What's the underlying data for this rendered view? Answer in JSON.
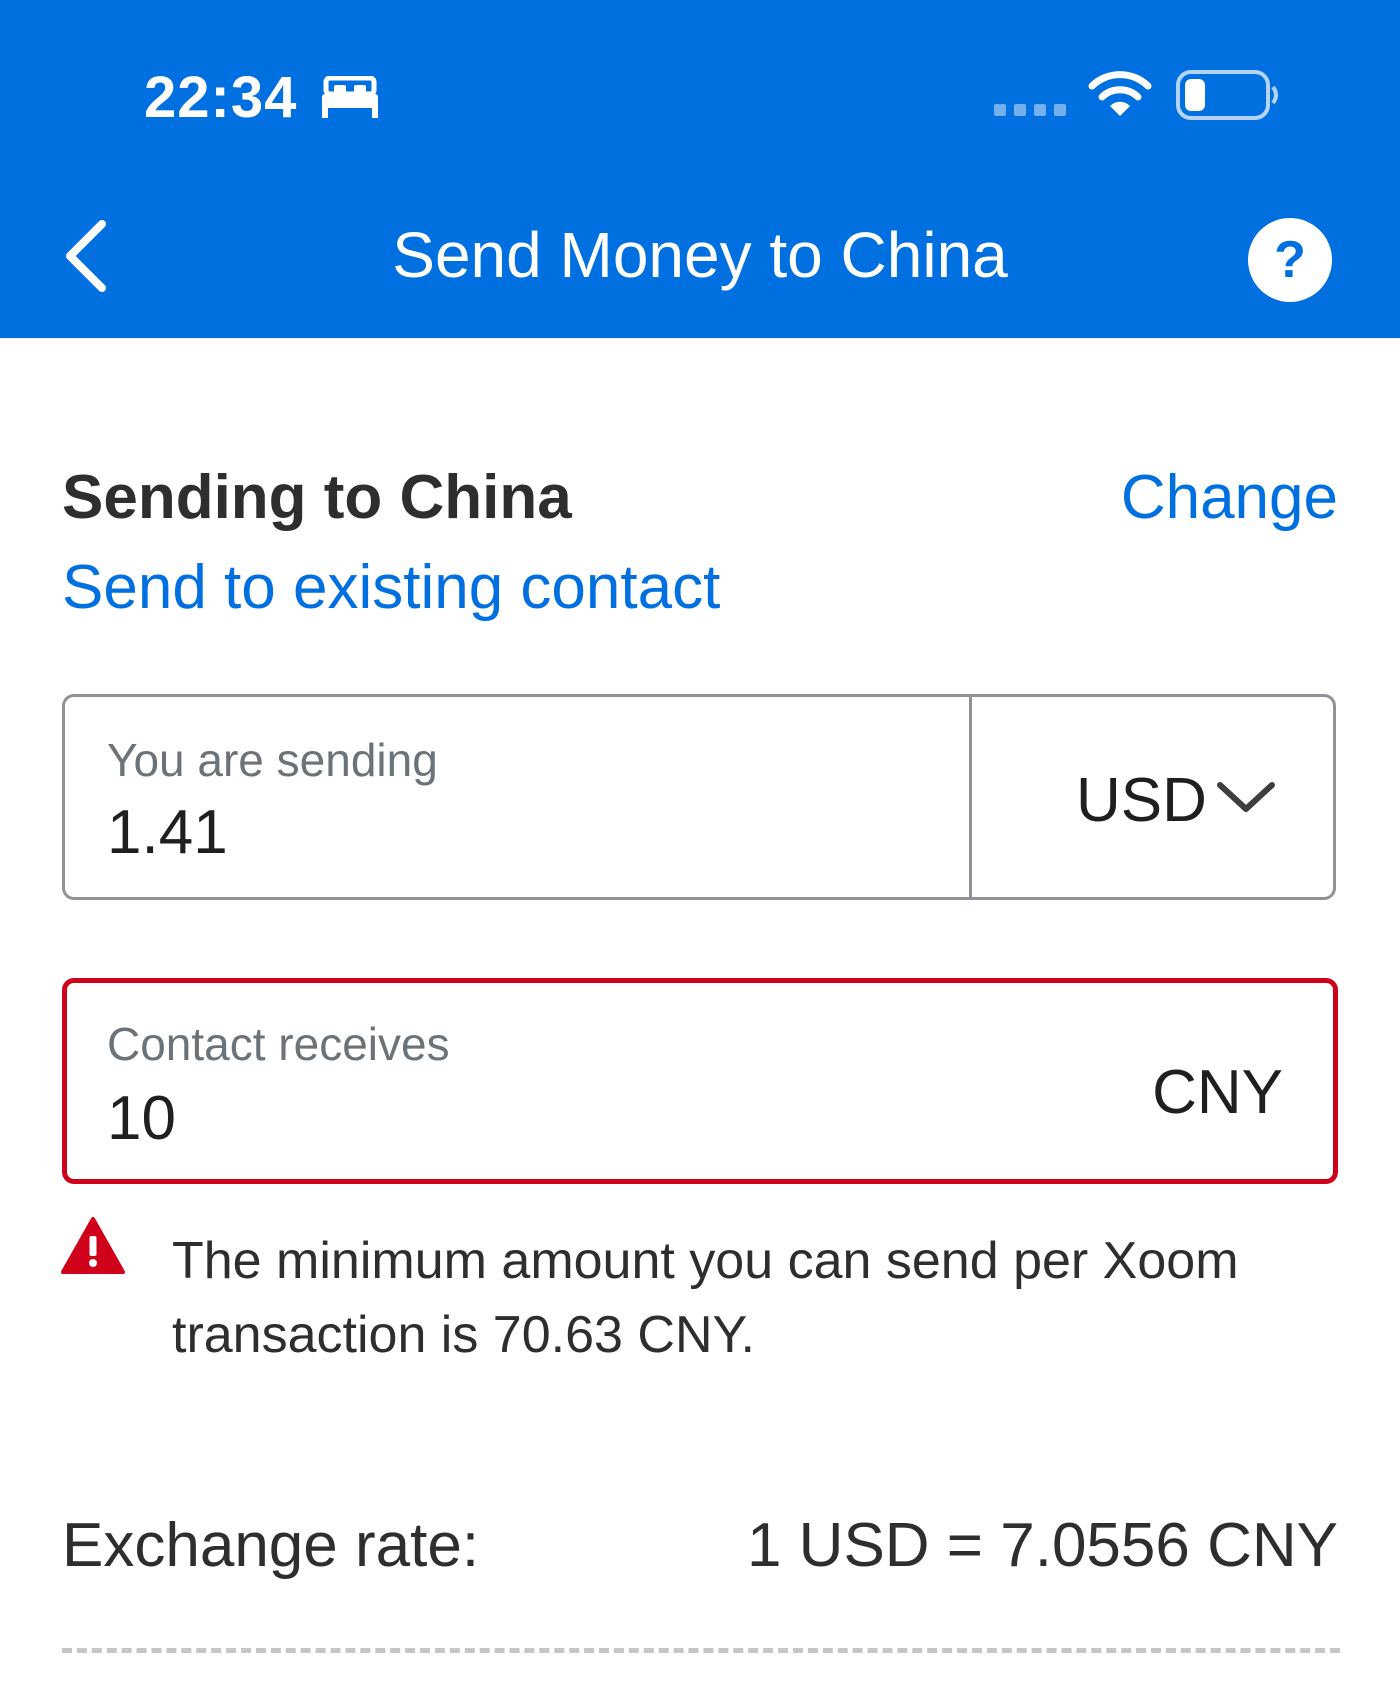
{
  "status_bar": {
    "time": "22:34",
    "icons": [
      "bed-icon",
      "signal-icon",
      "wifi-icon",
      "battery-icon"
    ]
  },
  "header": {
    "title": "Send Money to China",
    "back_icon": "chevron-left-icon",
    "help_label": "?"
  },
  "recipient": {
    "title": "Sending to China",
    "change_label": "Change",
    "existing_contact_label": "Send to existing contact"
  },
  "send_amount": {
    "label": "You are sending",
    "value": "1.41",
    "currency": "USD"
  },
  "receive_amount": {
    "label": "Contact receives",
    "value": "10",
    "currency": "CNY"
  },
  "error": {
    "message": "The minimum amount you can send per Xoom transaction is 70.63 CNY."
  },
  "exchange": {
    "label": "Exchange rate:",
    "value": "1 USD = 7.0556 CNY"
  },
  "colors": {
    "brand_blue": "#0070e0",
    "error_red": "#d0021b",
    "border_gray": "#8f9397"
  }
}
